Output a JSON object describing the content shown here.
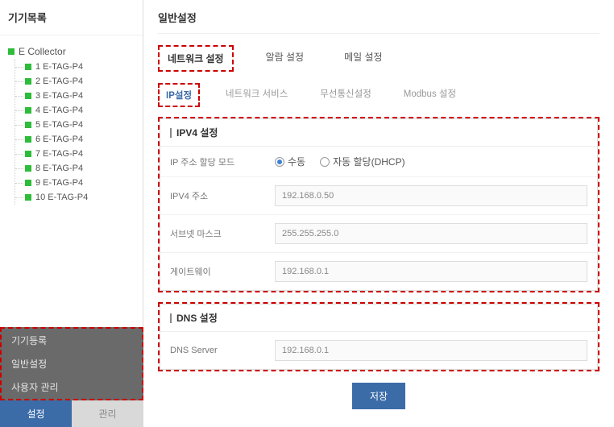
{
  "sidebar": {
    "title": "기기목록",
    "root_label": "E Collector",
    "items": [
      {
        "label": "1 E-TAG-P4"
      },
      {
        "label": "2 E-TAG-P4"
      },
      {
        "label": "3 E-TAG-P4"
      },
      {
        "label": "4 E-TAG-P4"
      },
      {
        "label": "5 E-TAG-P4"
      },
      {
        "label": "6 E-TAG-P4"
      },
      {
        "label": "7 E-TAG-P4"
      },
      {
        "label": "8 E-TAG-P4"
      },
      {
        "label": "9 E-TAG-P4"
      },
      {
        "label": "10 E-TAG-P4"
      }
    ],
    "settings_menu": {
      "items": [
        "기기등록",
        "일반설정",
        "사용자 관리"
      ]
    },
    "bottom_tabs": {
      "active": "설정",
      "inactive": "관리"
    }
  },
  "main": {
    "title": "일반설정",
    "tabs": [
      {
        "label": "네트워크 설정",
        "active": true
      },
      {
        "label": "알람 설정"
      },
      {
        "label": "메일 설정"
      }
    ],
    "subtabs": [
      {
        "label": "IP설정",
        "active": true
      },
      {
        "label": "네트워크 서비스"
      },
      {
        "label": "무선통신설정"
      },
      {
        "label": "Modbus 설정"
      }
    ],
    "ipv4_panel": {
      "title": "IPV4 설정",
      "mode_label": "IP 주소 할당 모드",
      "mode_manual": "수동",
      "mode_dhcp": "자동 할당(DHCP)",
      "mode_selected": "manual",
      "addr_label": "IPV4 주소",
      "addr_value": "192.168.0.50",
      "mask_label": "서브넷 마스크",
      "mask_value": "255.255.255.0",
      "gw_label": "게이트웨이",
      "gw_value": "192.168.0.1"
    },
    "dns_panel": {
      "title": "DNS 설정",
      "server_label": "DNS Server",
      "server_value": "192.168.0.1"
    },
    "save_label": "저장"
  }
}
